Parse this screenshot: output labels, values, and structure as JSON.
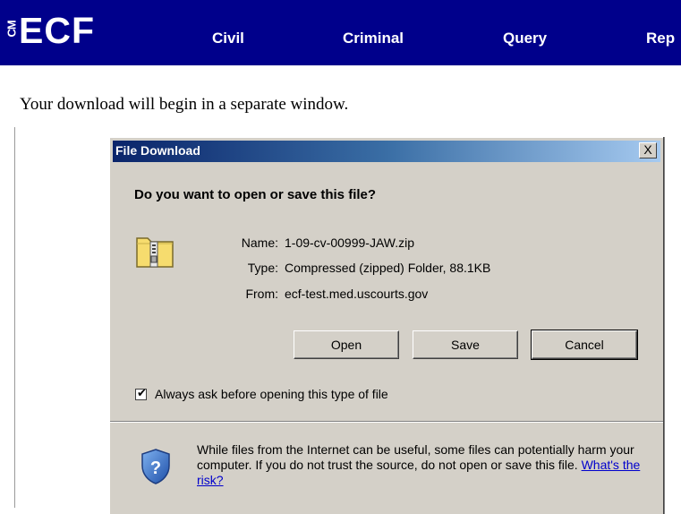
{
  "nav": {
    "logo_cm": "CM",
    "logo_ecf": "ECF",
    "items": [
      {
        "label": "Civil"
      },
      {
        "label": "Criminal"
      },
      {
        "label": "Query"
      },
      {
        "label": "Rep"
      }
    ]
  },
  "page": {
    "message": "Your download will begin in a separate window."
  },
  "dialog": {
    "title": "File Download",
    "close_label": "X",
    "question": "Do you want to open or save this file?",
    "file_icon": "zip-folder-icon",
    "fields": [
      {
        "label": "Name:",
        "value": "1-09-cv-00999-JAW.zip"
      },
      {
        "label": "Type:",
        "value": "Compressed (zipped) Folder, 88.1KB"
      },
      {
        "label": "From:",
        "value": "ecf-test.med.uscourts.gov"
      }
    ],
    "buttons": {
      "open": "Open",
      "save": "Save",
      "cancel": "Cancel"
    },
    "checkbox": {
      "label": "Always ask before opening this type of file",
      "checked": true
    },
    "warning": {
      "icon": "shield-question-icon",
      "text": "While files from the Internet can be useful, some files can potentially harm your computer. If you do not trust the source, do not open or save this file.",
      "link": "What's the risk?"
    }
  },
  "colors": {
    "navbar": "#00008b",
    "dialog_bg": "#d4d0c8",
    "titlebar_start": "#0a246a",
    "titlebar_end": "#a6caf0",
    "link": "#0000cc"
  }
}
